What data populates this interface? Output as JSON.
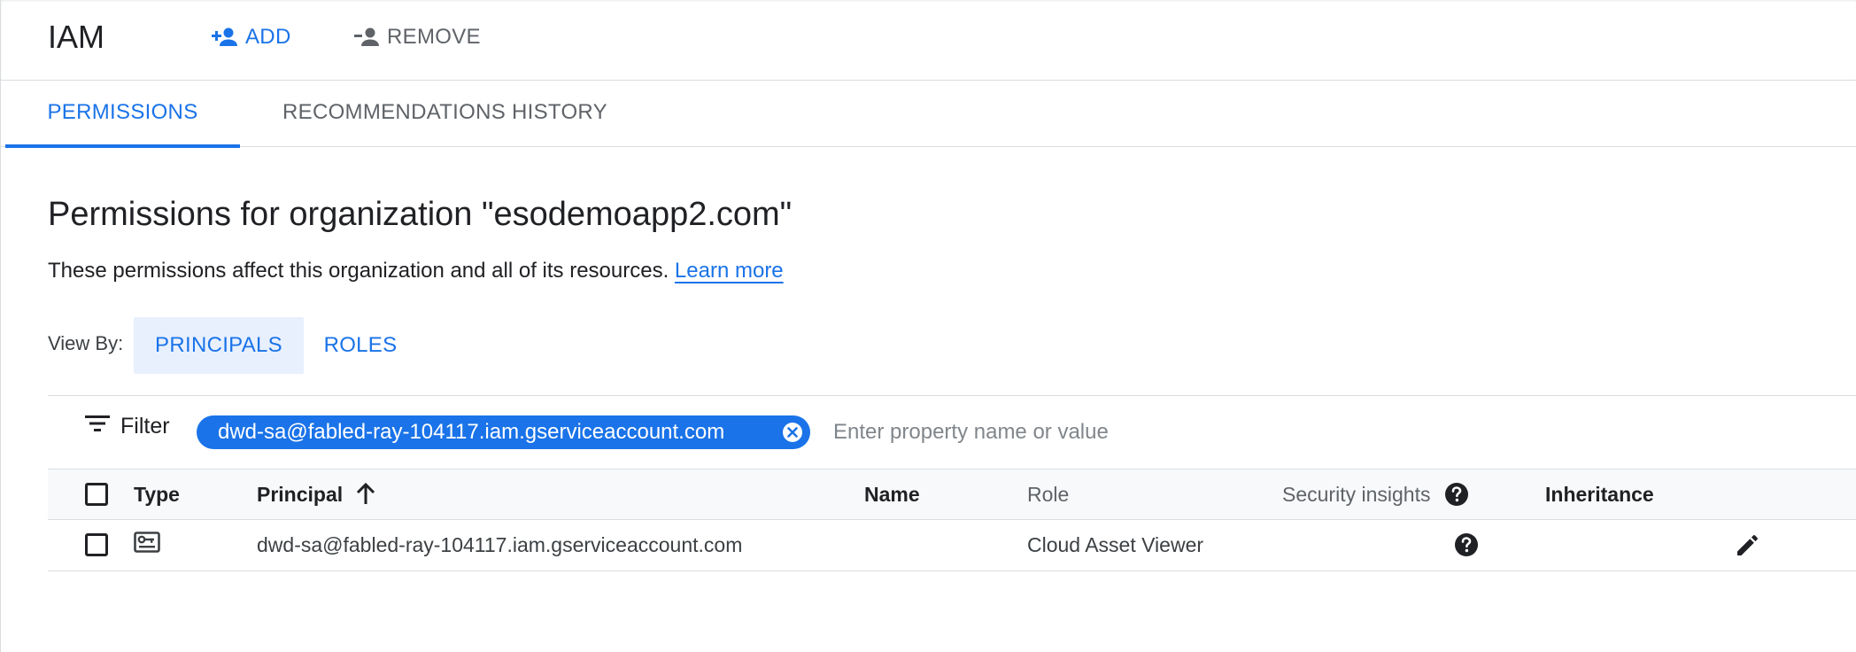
{
  "header": {
    "title": "IAM",
    "add_label": "ADD",
    "remove_label": "REMOVE"
  },
  "tabs": [
    {
      "label": "PERMISSIONS",
      "active": true
    },
    {
      "label": "RECOMMENDATIONS HISTORY",
      "active": false
    }
  ],
  "content": {
    "title": "Permissions for organization \"esodemoapp2.com\"",
    "description": "These permissions affect this organization and all of its resources.",
    "learn_more": "Learn more"
  },
  "view_by": {
    "label": "View By:",
    "options": [
      {
        "label": "PRINCIPALS",
        "selected": true
      },
      {
        "label": "ROLES",
        "selected": false
      }
    ]
  },
  "filter": {
    "label": "Filter",
    "chip": "dwd-sa@fabled-ray-104117.iam.gserviceaccount.com",
    "placeholder": "Enter property name or value"
  },
  "table": {
    "columns": {
      "type": "Type",
      "principal": "Principal",
      "name": "Name",
      "role": "Role",
      "security_insights": "Security insights",
      "inheritance": "Inheritance"
    },
    "rows": [
      {
        "type_icon": "service-account-icon",
        "principal": "dwd-sa@fabled-ray-104117.iam.gserviceaccount.com",
        "name": "",
        "role": "Cloud Asset Viewer",
        "security_insights_icon": "help-icon",
        "inheritance": ""
      }
    ]
  },
  "colors": {
    "accent": "#1a73e8",
    "accent_light": "#e8f0fe",
    "text": "#202124",
    "muted": "#5f6368",
    "border": "#dadce0"
  }
}
